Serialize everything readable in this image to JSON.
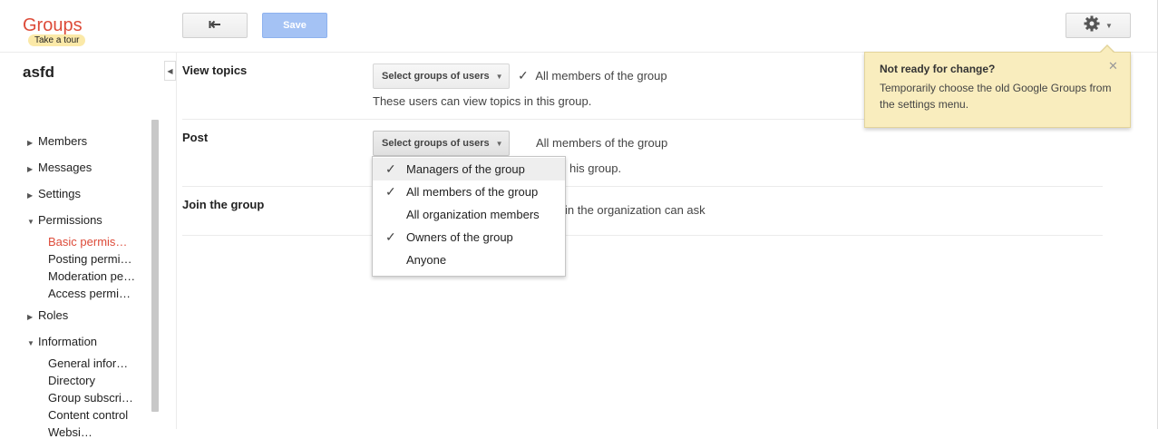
{
  "header": {
    "logo": "Groups",
    "tour": "Take a tour",
    "save_label": "Save"
  },
  "sidebar": {
    "group_name": "asfd",
    "items": [
      {
        "label": "Members"
      },
      {
        "label": "Messages"
      },
      {
        "label": "Settings"
      },
      {
        "label": "Permissions"
      },
      {
        "label": "Roles"
      },
      {
        "label": "Information"
      }
    ],
    "permissions_sub": [
      "Basic permis…",
      "Posting permi…",
      "Moderation pe…",
      "Access permi…"
    ],
    "information_sub": [
      "General infor…",
      "Directory",
      "Group subscri…",
      "Content control",
      "Websi…"
    ]
  },
  "rows": {
    "view": {
      "label": "View topics",
      "select_label": "Select groups of users",
      "value": "All members of the group",
      "desc": "These users can view topics in this group."
    },
    "post": {
      "label": "Post",
      "select_label": "Select groups of users",
      "value": "All members of the group",
      "desc_tail": "his group."
    },
    "join": {
      "label": "Join the group",
      "desc_tail": "in the organization can ask"
    }
  },
  "dropdown": {
    "options": [
      {
        "label": "Managers of the group",
        "checked": true
      },
      {
        "label": "All members of the group",
        "checked": true
      },
      {
        "label": "All organization members",
        "checked": false
      },
      {
        "label": "Owners of the group",
        "checked": true
      },
      {
        "label": "Anyone",
        "checked": false
      }
    ]
  },
  "notice": {
    "title": "Not ready for change?",
    "body": "Temporarily choose the old Google Groups from the settings menu."
  },
  "icons": {
    "back": "back-arrow-icon",
    "settings": "gear-icon",
    "close": "close-icon",
    "check": "check-icon"
  }
}
